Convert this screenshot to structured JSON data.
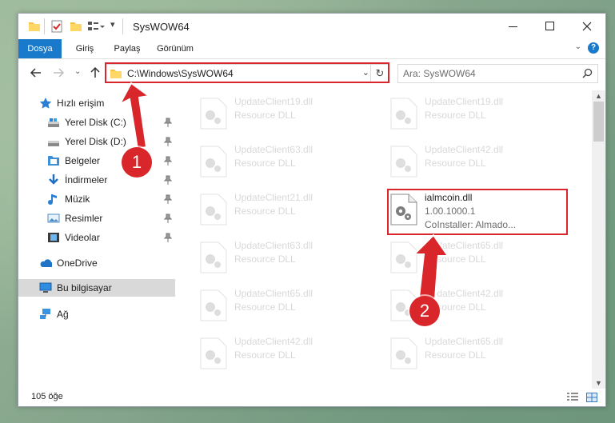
{
  "window": {
    "title": "SysWOW64",
    "controls": {
      "minimize": "minimize-icon",
      "maximize": "maximize-icon",
      "close": "close-icon"
    }
  },
  "ribbon": {
    "tabs": [
      {
        "label": "Dosya",
        "active": true
      },
      {
        "label": "Giriş"
      },
      {
        "label": "Paylaş"
      },
      {
        "label": "Görünüm"
      }
    ],
    "help": "?"
  },
  "navigation": {
    "address": "C:\\Windows\\SysWOW64",
    "search_placeholder": "Ara: SysWOW64"
  },
  "sidebar": {
    "items": [
      {
        "label": "Hızlı erişim",
        "icon": "star-icon",
        "pinned": false
      },
      {
        "label": "Yerel Disk (C:)",
        "icon": "drive-icon",
        "pinned": true
      },
      {
        "label": "Yerel Disk (D:)",
        "icon": "drive-icon",
        "pinned": true
      },
      {
        "label": "Belgeler",
        "icon": "documents-icon",
        "pinned": true
      },
      {
        "label": "İndirmeler",
        "icon": "download-icon",
        "pinned": true
      },
      {
        "label": "Müzik",
        "icon": "music-icon",
        "pinned": true
      },
      {
        "label": "Resimler",
        "icon": "pictures-icon",
        "pinned": true
      },
      {
        "label": "Videolar",
        "icon": "videos-icon",
        "pinned": true
      },
      {
        "label": "OneDrive",
        "icon": "cloud-icon",
        "pinned": false
      },
      {
        "label": "Bu bilgisayar",
        "icon": "computer-icon",
        "selected": true
      },
      {
        "label": "Ağ",
        "icon": "network-icon",
        "pinned": false
      }
    ]
  },
  "files": {
    "left": [
      {
        "name": "UpdateClient19.dll",
        "desc": "Resource DLL"
      },
      {
        "name": "UpdateClient63.dll",
        "desc": "Resource DLL"
      },
      {
        "name": "UpdateClient21.dll",
        "desc": "Resource DLL"
      },
      {
        "name": "UpdateClient63.dll",
        "desc": "Resource DLL"
      },
      {
        "name": "UpdateClient65.dll",
        "desc": "Resource DLL"
      },
      {
        "name": "UpdateClient42.dll",
        "desc": "Resource DLL"
      }
    ],
    "right": [
      {
        "name": "UpdateClient19.dll",
        "desc": "Resource DLL"
      },
      {
        "name": "UpdateClient42.dll",
        "desc": "Resource DLL"
      },
      {
        "name": "ialmcoin.dll",
        "desc": "1.00.1000.1",
        "extra": "CoInstaller: Almado...",
        "highlighted": true
      },
      {
        "name": "UpdateClient65.dll",
        "desc": "Resource DLL"
      },
      {
        "name": "UpdateClient42.dll",
        "desc": "Resource DLL"
      },
      {
        "name": "UpdateClient65.dll",
        "desc": "Resource DLL"
      }
    ]
  },
  "status": {
    "item_count": "105 öğe"
  },
  "annotations": {
    "step1": "1",
    "step2": "2",
    "color": "#d8262b"
  }
}
